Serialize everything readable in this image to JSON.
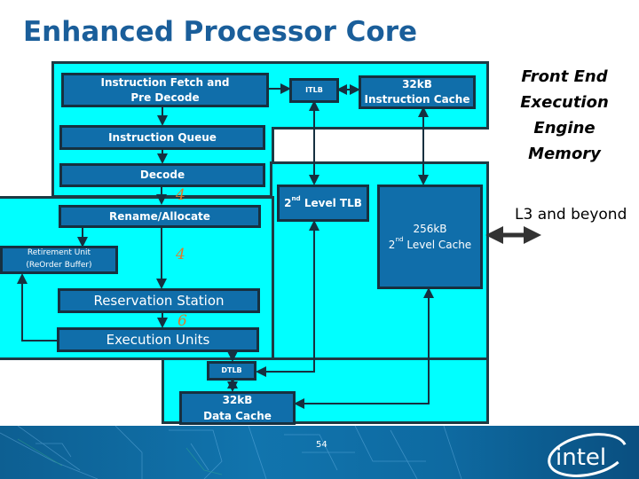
{
  "slide": {
    "title": "Enhanced Processor Core",
    "page_number": "54",
    "logo_text": "intel"
  },
  "colors": {
    "title": "#1a5e9a",
    "region_fill": "#00ffff",
    "block_fill": "#106eaa",
    "block_border": "#163040",
    "width_number": "#e07a2a"
  },
  "legend": {
    "items": [
      "Front End",
      "Execution",
      "Engine",
      "Memory"
    ]
  },
  "external": {
    "label": "L3 and beyond"
  },
  "blocks": {
    "fetch": {
      "line1": "Instruction Fetch and",
      "line2": "Pre Decode"
    },
    "itlb": {
      "label": "ITLB"
    },
    "icache": {
      "line1": "32kB",
      "line2": "Instruction Cache"
    },
    "queue": {
      "label": "Instruction Queue"
    },
    "decode": {
      "label": "Decode"
    },
    "l2tlb": {
      "ord": "2",
      "sup": "nd",
      "rest": " Level TLB"
    },
    "l2cache": {
      "line1": "256kB",
      "ord": "2",
      "sup": "nd",
      "rest": " Level Cache"
    },
    "rename": {
      "label": "Rename/Allocate"
    },
    "retire": {
      "line1": "Retirement Unit",
      "line2": "(ReOrder Buffer)"
    },
    "rs": {
      "label": "Reservation Station"
    },
    "exec": {
      "label": "Execution Units"
    },
    "dtlb": {
      "label": "DTLB"
    },
    "dcache": {
      "line1": "32kB",
      "line2": "Data Cache"
    }
  },
  "widths": {
    "decode_to_rename": "4",
    "rename_to_rs": "4",
    "rs_to_exec": "6"
  }
}
